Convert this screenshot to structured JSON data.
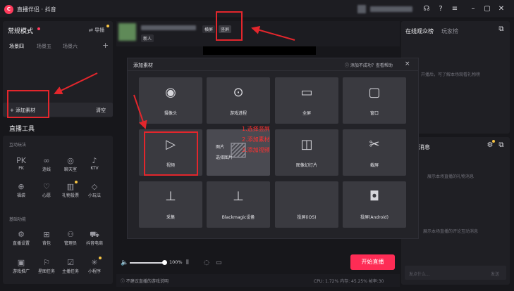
{
  "app": {
    "logo_text": "C",
    "title": "直播伴侣 · 抖音"
  },
  "mode": {
    "title": "常规模式",
    "import_label": "导播"
  },
  "scenes": {
    "tabs": [
      "场景四",
      "场景五",
      "场景六"
    ],
    "add": "+"
  },
  "sources": {
    "add_label": "+ 添加素材",
    "clear_label": "清空"
  },
  "tools": {
    "title": "直播工具",
    "interactive_label": "互动玩法",
    "interactive": [
      {
        "icon": "PK",
        "label": "PK"
      },
      {
        "icon": "∞",
        "label": "连线"
      },
      {
        "icon": "◎",
        "label": "聊天室"
      },
      {
        "icon": "♪",
        "label": "KTV"
      },
      {
        "icon": "⊕",
        "label": "福袋"
      },
      {
        "icon": "♡",
        "label": "心愿"
      },
      {
        "icon": "▥",
        "label": "礼物投票"
      },
      {
        "icon": "◇",
        "label": "小玩法"
      }
    ],
    "basic_label": "基础功能",
    "basic": [
      {
        "icon": "⚙",
        "label": "直播设置"
      },
      {
        "icon": "⊞",
        "label": "背包"
      },
      {
        "icon": "⚇",
        "label": "管理员"
      },
      {
        "icon": "⛟",
        "label": "抖音电商"
      },
      {
        "icon": "▣",
        "label": "游戏推广"
      },
      {
        "icon": "⚐",
        "label": "星图任务"
      },
      {
        "icon": "☑",
        "label": "主播任务"
      },
      {
        "icon": "✳",
        "label": "小程序"
      }
    ]
  },
  "header": {
    "landscape_label": "横屏",
    "portrait_label": "竖屏",
    "sub_label": "新人"
  },
  "controls": {
    "volume_pct": "100%",
    "start_label": "开始直播"
  },
  "footer": {
    "tip": "不建议直播的游戏说明",
    "stats": "CPU: 1.72%  内存: 45.25%  帧率:30"
  },
  "right": {
    "tab_audience": "在线观众榜",
    "tab_players": "玩家榜",
    "audience_hint": "开播后，可了解本场观看礼物榜",
    "messages_title": "消息",
    "gift_hint": "展示本场直播的礼物消息",
    "comment_hint": "展示本场直播的评论互动消息",
    "input_placeholder": "发点什么...",
    "send_label": "发送"
  },
  "modal": {
    "title": "添加素材",
    "help": "ⓘ 添加不成功？查看帮助",
    "close": "×",
    "items": [
      {
        "icon": "◉",
        "label": "摄像头"
      },
      {
        "icon": "⊙",
        "label": "游戏进程"
      },
      {
        "icon": "▭",
        "label": "全屏"
      },
      {
        "icon": "▢",
        "label": "窗口"
      },
      {
        "icon": "▷",
        "label": "视频"
      },
      {
        "icon": "▨",
        "label": "图片"
      },
      {
        "icon": "◫",
        "label": "图像幻灯片"
      },
      {
        "icon": "✂",
        "label": "截屏"
      },
      {
        "icon": "⊥",
        "label": "采集"
      },
      {
        "icon": "⊥",
        "label": "Blackmagic设备"
      },
      {
        "icon": "",
        "label": "投屏(iOS)"
      },
      {
        "icon": "◘",
        "label": "投屏(Android)"
      }
    ],
    "image_select": "选择图片"
  },
  "annotations": [
    "1.选择竖屏",
    "2.添加素材",
    "3.添加视频"
  ]
}
